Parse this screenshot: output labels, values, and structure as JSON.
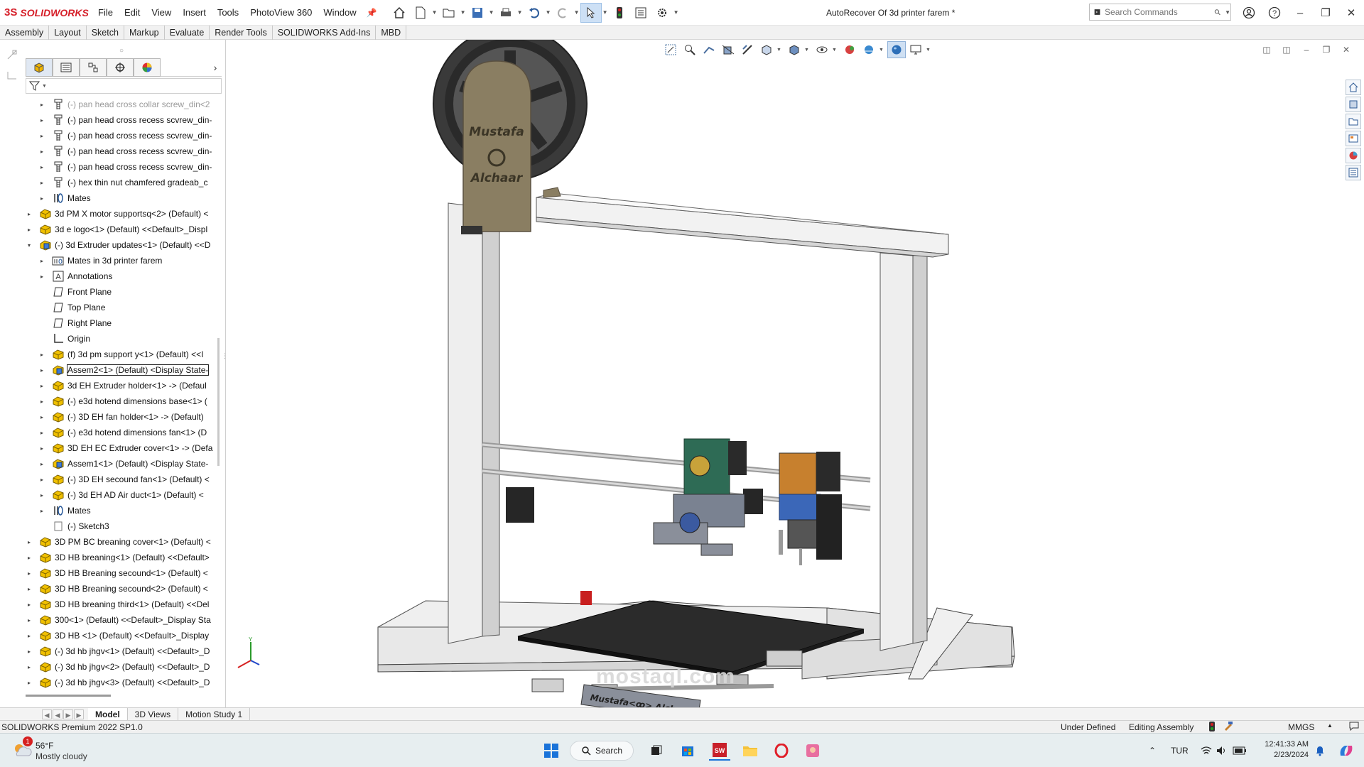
{
  "app": {
    "brand_ds": "3S",
    "brand_name": "SOLIDWORKS"
  },
  "menu": [
    "File",
    "Edit",
    "View",
    "Insert",
    "Tools",
    "PhotoView 360",
    "Window"
  ],
  "document_title": "AutoRecover Of 3d printer farem *",
  "search": {
    "placeholder": "Search Commands"
  },
  "command_tabs": [
    "Assembly",
    "Layout",
    "Sketch",
    "Markup",
    "Evaluate",
    "Render Tools",
    "SOLIDWORKS Add-Ins",
    "MBD"
  ],
  "tree": [
    {
      "label": "(-) pan head cross collar screw_din<2",
      "level": 2,
      "icon": "screw-icon",
      "expander": "▸",
      "faded": true
    },
    {
      "label": "(-) pan head cross recess scvrew_din-",
      "level": 2,
      "icon": "screw-icon",
      "expander": "▸"
    },
    {
      "label": "(-) pan head cross recess scvrew_din-",
      "level": 2,
      "icon": "screw-icon",
      "expander": "▸"
    },
    {
      "label": "(-) pan head cross recess scvrew_din-",
      "level": 2,
      "icon": "screw-icon",
      "expander": "▸"
    },
    {
      "label": "(-) pan head cross recess scvrew_din-",
      "level": 2,
      "icon": "screw-icon",
      "expander": "▸"
    },
    {
      "label": "(-) hex thin nut chamfered gradeab_c",
      "level": 2,
      "icon": "screw-icon",
      "expander": "▸"
    },
    {
      "label": "Mates",
      "level": 2,
      "icon": "mates-icon",
      "expander": "▸"
    },
    {
      "label": "3d PM X motor supportsq<2> (Default) <",
      "level": 1,
      "icon": "part-icon",
      "expander": "▸"
    },
    {
      "label": "3d e logo<1> (Default) <<Default>_Displ",
      "level": 1,
      "icon": "part-icon",
      "expander": "▸"
    },
    {
      "label": "(-) 3d Extruder updates<1> (Default) <<D",
      "level": 1,
      "icon": "assembly-icon",
      "expander": "▾"
    },
    {
      "label": "Mates in 3d printer farem",
      "level": 2,
      "icon": "mates-folder-icon",
      "expander": "▸"
    },
    {
      "label": "Annotations",
      "level": 2,
      "icon": "annotations-icon",
      "expander": "▸"
    },
    {
      "label": "Front Plane",
      "level": 2,
      "icon": "plane-icon",
      "expander": ""
    },
    {
      "label": "Top Plane",
      "level": 2,
      "icon": "plane-icon",
      "expander": ""
    },
    {
      "label": "Right Plane",
      "level": 2,
      "icon": "plane-icon",
      "expander": ""
    },
    {
      "label": "Origin",
      "level": 2,
      "icon": "origin-icon",
      "expander": ""
    },
    {
      "label": "(f) 3d pm support y<1> (Default) <<I",
      "level": 2,
      "icon": "part-icon",
      "expander": "▸"
    },
    {
      "label": "Assem2<1> (Default) <Display State-",
      "level": 2,
      "icon": "assembly-icon",
      "expander": "▸",
      "selected": true
    },
    {
      "label": "3d EH Extruder holder<1> -> (Defaul",
      "level": 2,
      "icon": "part-icon",
      "expander": "▸"
    },
    {
      "label": "(-) e3d hotend dimensions base<1> (",
      "level": 2,
      "icon": "part-icon",
      "expander": "▸"
    },
    {
      "label": "(-) 3D EH fan holder<1> -> (Default)",
      "level": 2,
      "icon": "part-icon",
      "expander": "▸"
    },
    {
      "label": "(-) e3d hotend dimensions fan<1> (D",
      "level": 2,
      "icon": "part-icon",
      "expander": "▸"
    },
    {
      "label": "3D EH EC Extruder cover<1> -> (Defa",
      "level": 2,
      "icon": "part-icon",
      "expander": "▸"
    },
    {
      "label": "Assem1<1> (Default) <Display State-",
      "level": 2,
      "icon": "assembly-icon",
      "expander": "▸"
    },
    {
      "label": "(-) 3D EH secound fan<1> (Default) <",
      "level": 2,
      "icon": "part-icon",
      "expander": "▸"
    },
    {
      "label": "(-) 3d EH AD Air duct<1> (Default) <",
      "level": 2,
      "icon": "part-icon",
      "expander": "▸"
    },
    {
      "label": "Mates",
      "level": 2,
      "icon": "mates-icon",
      "expander": "▸"
    },
    {
      "label": "(-) Sketch3",
      "level": 2,
      "icon": "sketch-icon",
      "expander": ""
    },
    {
      "label": "3D PM BC breaning cover<1> (Default) <",
      "level": 1,
      "icon": "part-icon",
      "expander": "▸"
    },
    {
      "label": "3D HB breaning<1> (Default) <<Default>",
      "level": 1,
      "icon": "part-icon",
      "expander": "▸"
    },
    {
      "label": "3D HB Breaning  secound<1> (Default) <",
      "level": 1,
      "icon": "part-icon",
      "expander": "▸"
    },
    {
      "label": "3D HB Breaning  secound<2> (Default) <",
      "level": 1,
      "icon": "part-icon",
      "expander": "▸"
    },
    {
      "label": "3D HB breaning third<1> (Default) <<Del",
      "level": 1,
      "icon": "part-icon",
      "expander": "▸"
    },
    {
      "label": "300<1> (Default) <<Default>_Display Sta",
      "level": 1,
      "icon": "part-icon",
      "expander": "▸"
    },
    {
      "label": "3D HB <1> (Default) <<Default>_Display",
      "level": 1,
      "icon": "part-icon",
      "expander": "▸"
    },
    {
      "label": "(-) 3d hb jhgv<1> (Default) <<Default>_D",
      "level": 1,
      "icon": "part-icon",
      "expander": "▸"
    },
    {
      "label": "(-) 3d hb jhgv<2> (Default) <<Default>_D",
      "level": 1,
      "icon": "part-icon",
      "expander": "▸"
    },
    {
      "label": "(-) 3d hb jhgv<3> (Default) <<Default>_D",
      "level": 1,
      "icon": "part-icon",
      "expander": "▸"
    }
  ],
  "model_text": {
    "spool_line1": "Mustafa",
    "spool_line2": "Alchaar",
    "bed_text": "Mustafa<ꝏ> Alchaar"
  },
  "watermark": "mostaql.com",
  "sheet_tabs": [
    "Model",
    "3D Views",
    "Motion Study 1"
  ],
  "status": {
    "version": "SOLIDWORKS Premium 2022 SP1.0",
    "definition": "Under Defined",
    "mode": "Editing Assembly",
    "units": "MMGS"
  },
  "taskbar": {
    "temp": "56°F",
    "weather": "Mostly cloudy",
    "weather_badge": "1",
    "search": "Search",
    "lang": "TUR",
    "time": "12:41:33 AM",
    "date": "2/23/2024"
  },
  "colors": {
    "accent": "#d6202a",
    "tan": "#8a7e62",
    "frame": "#e6e6e6",
    "bed": "#2b2b2b"
  }
}
